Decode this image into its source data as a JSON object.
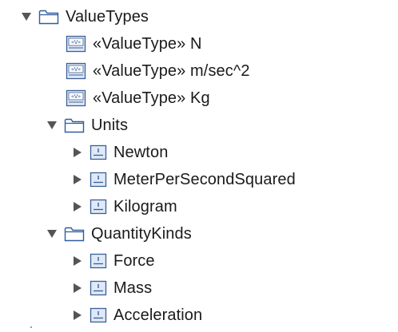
{
  "tree": {
    "root": {
      "label": "ValueTypes",
      "expanded": true,
      "icon": "folder-icon"
    },
    "value_types": [
      {
        "label": "«ValueType» N",
        "icon": "value-type-icon"
      },
      {
        "label": "«ValueType» m/sec^2",
        "icon": "value-type-icon"
      },
      {
        "label": "«ValueType» Kg",
        "icon": "value-type-icon"
      }
    ],
    "units": {
      "label": "Units",
      "expanded": true,
      "icon": "folder-icon",
      "items": [
        {
          "label": "Newton",
          "expanded": false,
          "icon": "unit-icon"
        },
        {
          "label": "MeterPerSecondSquared",
          "expanded": false,
          "icon": "unit-icon"
        },
        {
          "label": "Kilogram",
          "expanded": false,
          "icon": "unit-icon"
        }
      ]
    },
    "quantity_kinds": {
      "label": "QuantityKinds",
      "expanded": true,
      "icon": "folder-icon",
      "items": [
        {
          "label": "Force",
          "expanded": false,
          "icon": "quantity-kind-icon"
        },
        {
          "label": "Mass",
          "expanded": false,
          "icon": "quantity-kind-icon"
        },
        {
          "label": "Acceleration",
          "expanded": false,
          "icon": "quantity-kind-icon"
        }
      ]
    }
  },
  "colors": {
    "folder_stroke": "#2f5d9e",
    "icon_stroke": "#3c5f96",
    "icon_fill": "#dfe9f7",
    "arrow": "#555555",
    "text": "#1a1a1a"
  }
}
